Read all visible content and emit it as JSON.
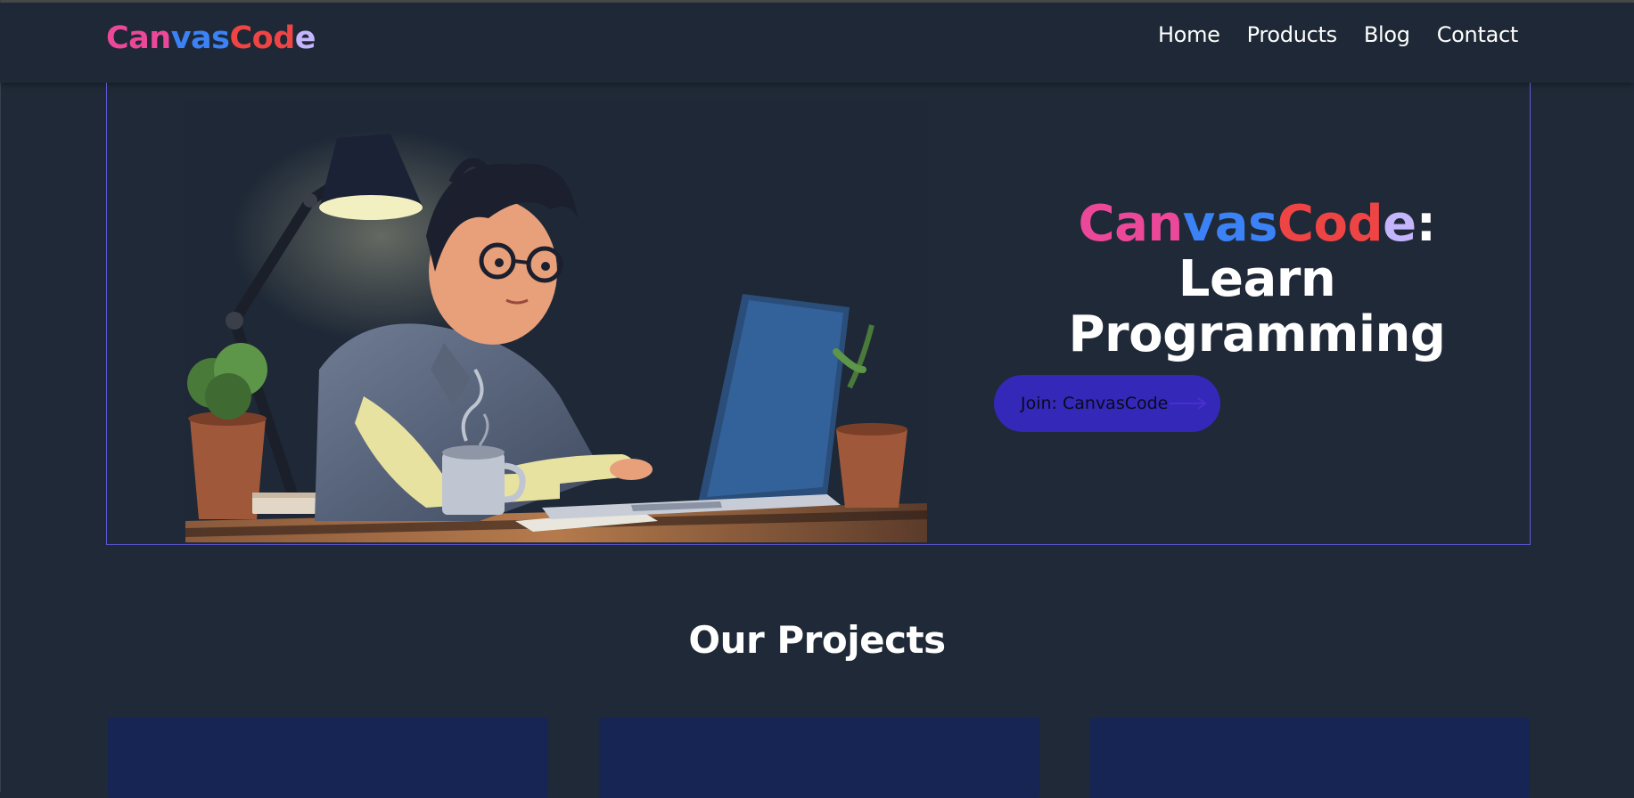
{
  "brand": {
    "segments": [
      {
        "text": "Can",
        "color": "#ec4899"
      },
      {
        "text": "vas",
        "color": "#3b82f6"
      },
      {
        "text": "Cod",
        "color": "#ef4444"
      },
      {
        "text": "e",
        "color": "#c4b5fd"
      }
    ]
  },
  "nav": {
    "items": [
      {
        "label": "Home"
      },
      {
        "label": "Products"
      },
      {
        "label": "Blog"
      },
      {
        "label": "Contact"
      }
    ]
  },
  "hero": {
    "title_rest": ": Learn Programming",
    "button_label": "Join: CanvasCode"
  },
  "projects": {
    "title": "Our Projects"
  },
  "colors": {
    "background": "#1f2937",
    "navbar": "#1e2836",
    "hero_border": "#5b5bd6",
    "button": "#3428b8",
    "card": "#172554"
  }
}
